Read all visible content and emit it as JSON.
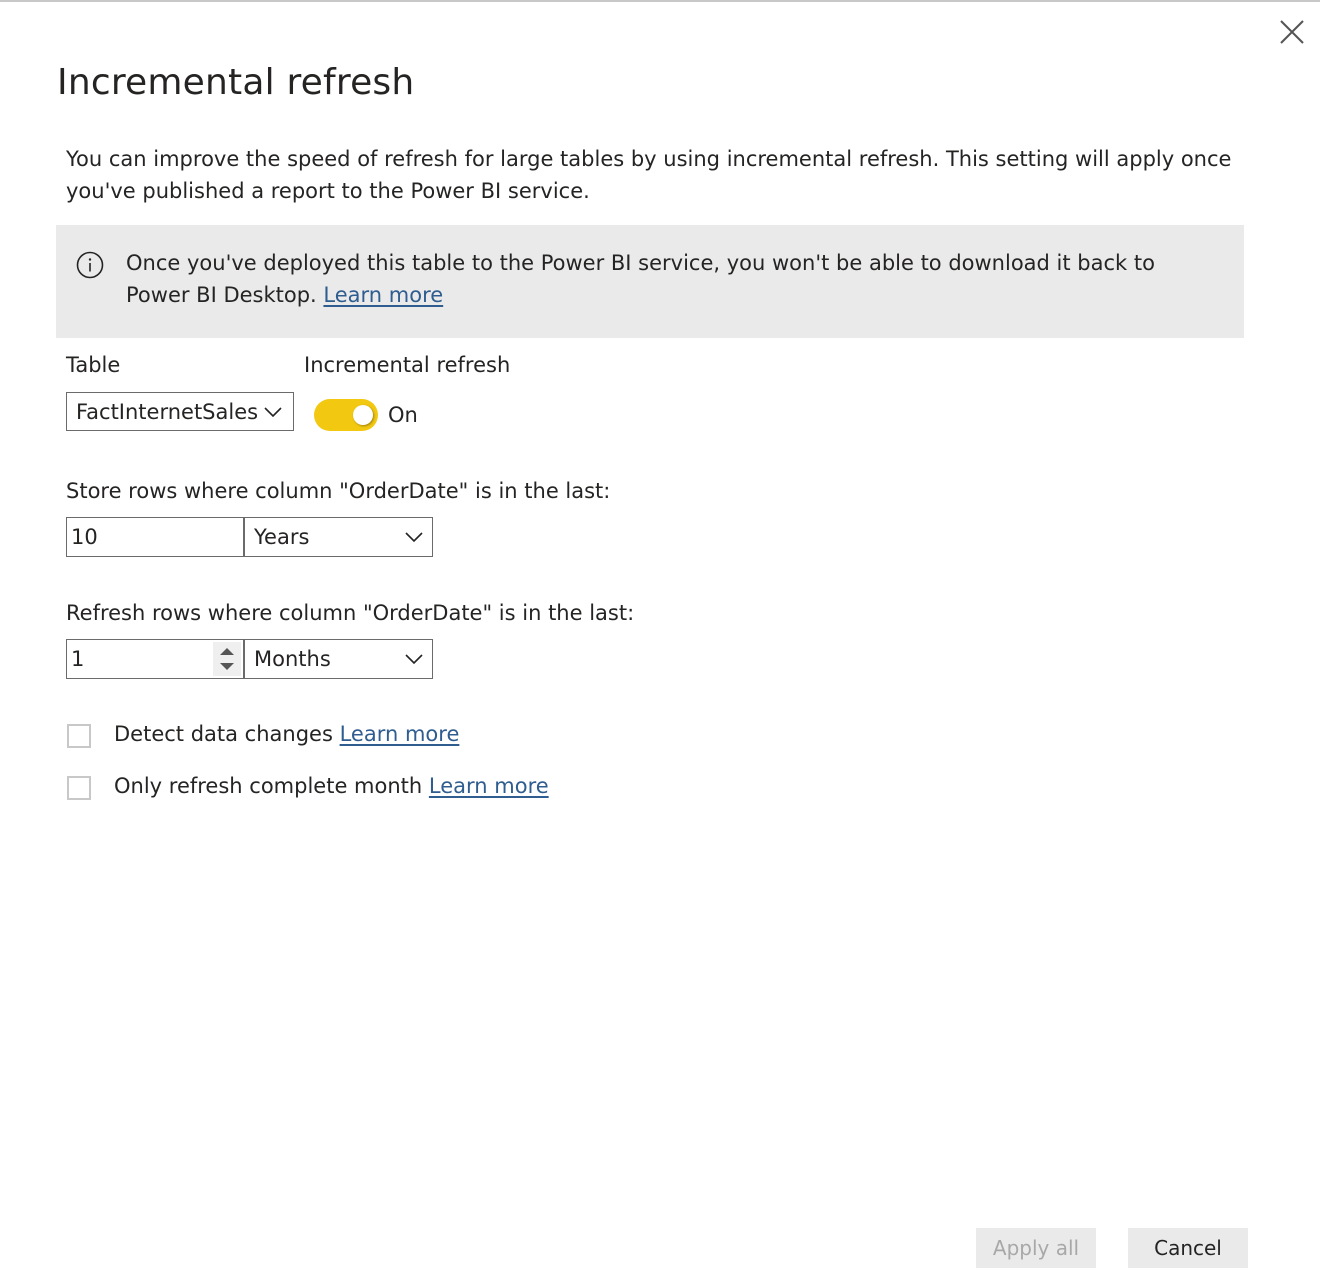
{
  "dialog": {
    "title": "Incremental refresh",
    "close_icon": "close-icon",
    "intro_text": "You can improve the speed of refresh for large tables by using incremental refresh. This setting will apply once you've published a report to the Power BI service."
  },
  "info_banner": {
    "icon": "info-icon",
    "text": "Once you've deployed this table to the Power BI service, you won't be able to download it back to Power BI Desktop.",
    "link_label": "Learn more"
  },
  "table_field": {
    "label": "Table",
    "selected": "FactInternetSales"
  },
  "incremental_toggle": {
    "label": "Incremental refresh",
    "state_label": "On",
    "on": true,
    "color": "#f2c811"
  },
  "store_rows": {
    "label": "Store rows where column \"OrderDate\" is in the last:",
    "value": "10",
    "unit": "Years"
  },
  "refresh_rows": {
    "label": "Refresh rows where column \"OrderDate\" is in the last:",
    "value": "1",
    "unit": "Months"
  },
  "options": [
    {
      "label": "Detect data changes",
      "link_label": "Learn more",
      "checked": false
    },
    {
      "label": "Only refresh complete month",
      "link_label": "Learn more",
      "checked": false
    }
  ],
  "footer": {
    "apply_label": "Apply all",
    "apply_disabled": true,
    "cancel_label": "Cancel"
  }
}
